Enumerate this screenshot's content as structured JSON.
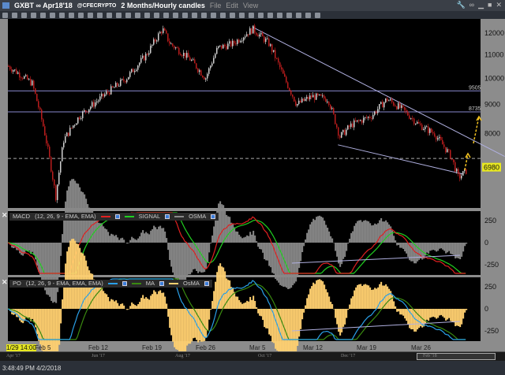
{
  "titlebar": {
    "symbol": "GXBT ∞ Apr18'18",
    "exchange": "@CFECRYPTO",
    "period": "2 Months/Hourly candles",
    "menu": [
      "File",
      "Edit",
      "View"
    ]
  },
  "price_axis": {
    "scale": "log",
    "ticks": [
      "12000",
      "11000",
      "10000",
      "9000",
      "8000"
    ],
    "last_price": "6980",
    "levels": [
      "9505",
      "8735"
    ]
  },
  "macd": {
    "label": "MACD",
    "params": "(12, 26, 9 - EMA, EMA)",
    "series": [
      "SIGNAL",
      "OSMA"
    ],
    "ticks": [
      "250",
      "0",
      "-250"
    ]
  },
  "po": {
    "label": "PO",
    "params": "(12, 26, 9 - EMA, EMA, EMA)",
    "series": [
      "MA",
      "OsMA"
    ],
    "ticks": [
      "250",
      "0",
      "-250"
    ]
  },
  "date_axis": {
    "cursor": "1/29 14:00",
    "labels": [
      "Feb 5",
      "Feb 12",
      "Feb 19",
      "Feb 26",
      "Mar 5",
      "Mar 12",
      "Mar 19",
      "Mar 26"
    ]
  },
  "scrollbar": {
    "labels": [
      "Apr '17",
      "Jun '17",
      "Aug '17",
      "Oct '17",
      "Dec '17",
      "Feb '18"
    ]
  },
  "status": {
    "time": "3:48:49 PM 4/2/2018"
  },
  "colors": {
    "up": "#e8e8e8",
    "down": "#d02020",
    "macd": "#e02020",
    "signal": "#20d020",
    "osma": "#888888",
    "po": "#2aa0e8",
    "po_ma": "#3a8a10",
    "po_osma": "#ffd070",
    "annotation": "#f0c020"
  },
  "chart_data": {
    "type": "candlestick",
    "approximate_path": [
      [
        "2018-02-01T05:00",
        10500
      ],
      [
        "2018-02-04T07:00",
        9800
      ],
      [
        "2018-02-05T19:00",
        8200
      ],
      [
        "2018-02-07T09:00",
        6200
      ],
      [
        "2018-02-08T10:00",
        7800
      ],
      [
        "2018-02-10T12:00",
        8600
      ],
      [
        "2018-02-13T12:00",
        9300
      ],
      [
        "2018-02-16T14:00",
        10000
      ],
      [
        "2018-02-19T05:00",
        11000
      ],
      [
        "2018-02-21T07:00",
        12200
      ],
      [
        "2018-02-22T07:00",
        11500
      ],
      [
        "2018-02-24T22:00",
        10800
      ],
      [
        "2018-02-26T22:00",
        10000
      ],
      [
        "2018-02-28T12:00",
        11300
      ],
      [
        "2018-03-02T12:00",
        11500
      ],
      [
        "2018-03-05T02:00",
        12200
      ],
      [
        "2018-03-07T05:00",
        11500
      ],
      [
        "2018-03-09T05:00",
        10000
      ],
      [
        "2018-03-10T19:00",
        9000
      ],
      [
        "2018-03-12T19:00",
        9300
      ],
      [
        "2018-03-14T22:00",
        9200
      ],
      [
        "2018-03-16T10:00",
        7900
      ],
      [
        "2018-03-18T00:00",
        8300
      ],
      [
        "2018-03-20T14:00",
        8600
      ],
      [
        "2018-03-22T14:00",
        9200
      ],
      [
        "2018-03-24T17:00",
        8800
      ],
      [
        "2018-03-26T17:00",
        8300
      ],
      [
        "2018-03-28T19:00",
        8000
      ],
      [
        "2018-03-30T22:00",
        7300
      ],
      [
        "2018-03-31T22:00",
        6700
      ],
      [
        "2018-04-02T00:00",
        6900
      ]
    ],
    "horizontal_lines": [
      9505,
      8735
    ],
    "dashed_line": 7240,
    "upper_trendline": [
      [
        "2018-03-05T02:00",
        12300
      ],
      [
        "2018-04-07T00:00",
        7300
      ]
    ],
    "lower_trendline": [
      [
        "2018-03-16T06:00",
        7650
      ],
      [
        "2018-04-01T12:00",
        6800
      ]
    ]
  }
}
